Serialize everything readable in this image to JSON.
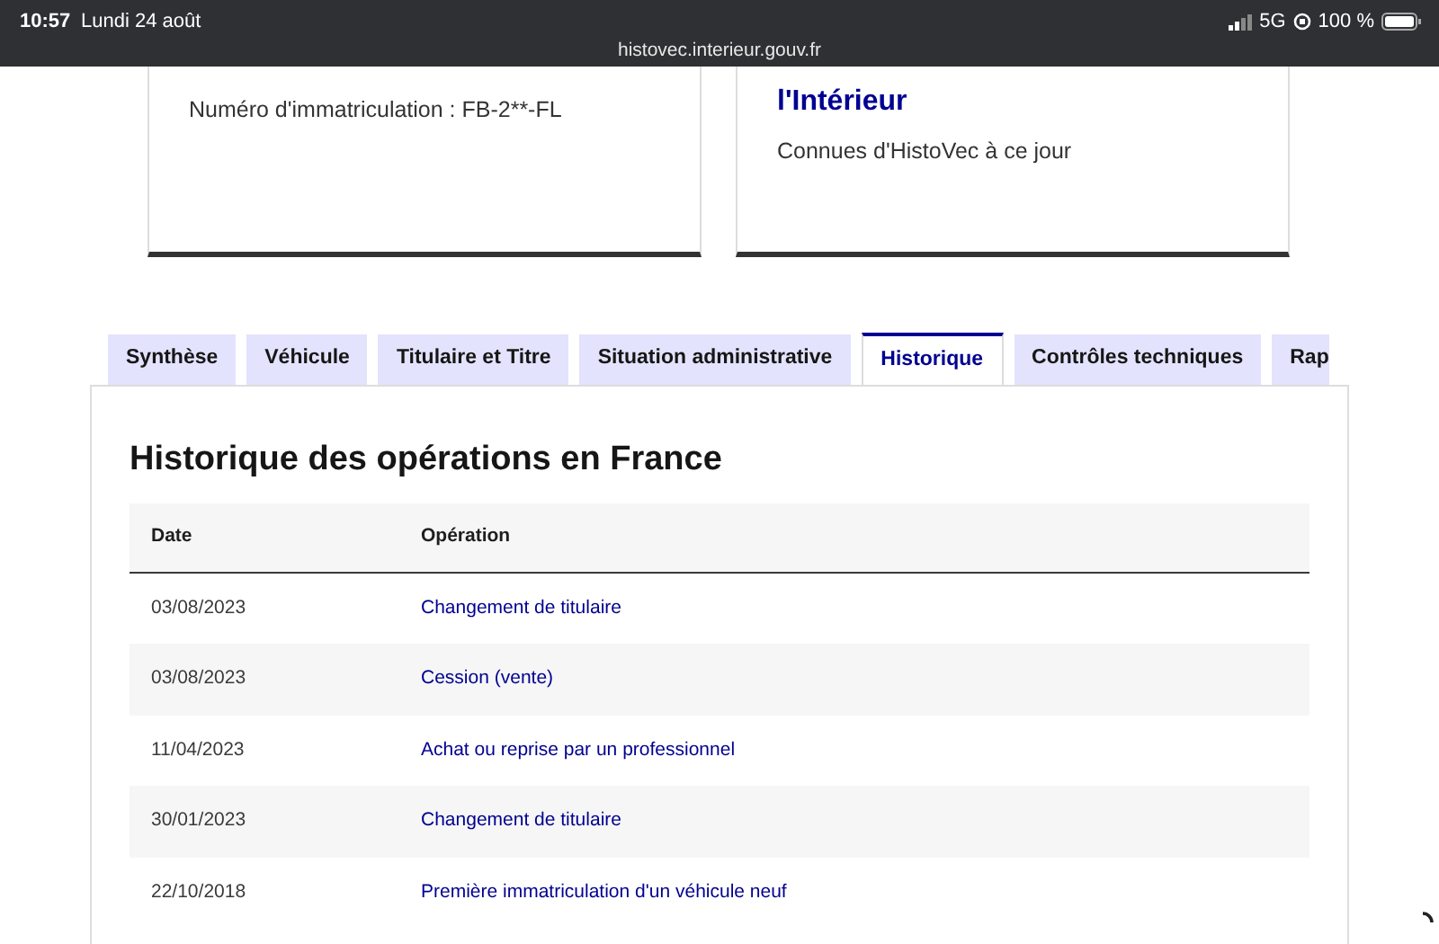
{
  "status_bar": {
    "time": "10:57",
    "date": "Lundi 24 août",
    "url": "histovec.interieur.gouv.fr",
    "network": "5G",
    "battery": "100 %"
  },
  "cards": [
    {
      "text": "Numéro d'immatriculation : FB-2**-FL"
    },
    {
      "title": "l'Intérieur",
      "text": "Connues d'HistoVec à ce jour"
    }
  ],
  "tabs": [
    {
      "label": "Synthèse",
      "selected": false
    },
    {
      "label": "Véhicule",
      "selected": false
    },
    {
      "label": "Titulaire et Titre",
      "selected": false
    },
    {
      "label": "Situation administrative",
      "selected": false
    },
    {
      "label": "Historique",
      "selected": true
    },
    {
      "label": "Contrôles techniques",
      "selected": false
    },
    {
      "label": "Rap",
      "selected": false
    }
  ],
  "panel": {
    "heading": "Historique des opérations en France",
    "table": {
      "columns": [
        "Date",
        "Opération"
      ],
      "rows": [
        {
          "date": "03/08/2023",
          "operation": "Changement de titulaire"
        },
        {
          "date": "03/08/2023",
          "operation": "Cession (vente)"
        },
        {
          "date": "11/04/2023",
          "operation": "Achat ou reprise par un professionnel"
        },
        {
          "date": "30/01/2023",
          "operation": "Changement de titulaire"
        },
        {
          "date": "22/10/2018",
          "operation": "Première immatriculation d'un véhicule neuf"
        }
      ]
    }
  }
}
